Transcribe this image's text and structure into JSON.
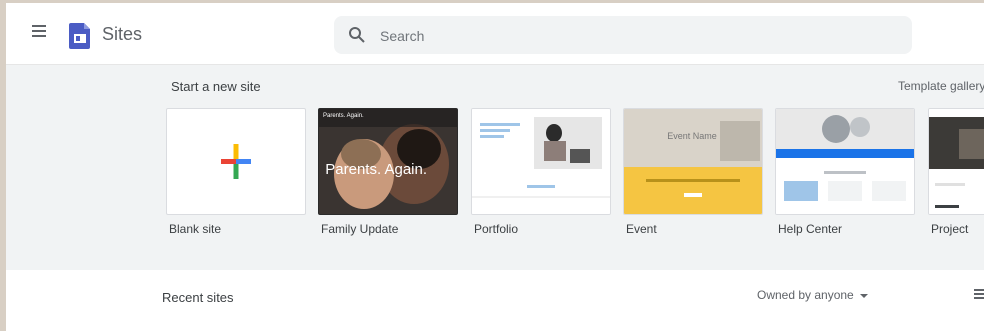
{
  "header": {
    "app_title": "Sites",
    "menu_icon": "hamburger-menu-icon",
    "logo_icon": "google-sites-logo-icon",
    "search_placeholder": "Search",
    "search_value": ""
  },
  "templates_section": {
    "title": "Start a new site",
    "gallery_link": "Template gallery",
    "templates": [
      {
        "label": "Blank site",
        "thumb_icon": "plus-icon"
      },
      {
        "label": "Family Update",
        "thumb_headline": "Parents. Again.",
        "thumb_header": "Parents. Again."
      },
      {
        "label": "Portfolio"
      },
      {
        "label": "Event",
        "thumb_headline": "Event Name"
      },
      {
        "label": "Help Center"
      },
      {
        "label": "Project"
      }
    ]
  },
  "recent": {
    "title": "Recent sites",
    "owner_filter": "Owned by anyone",
    "view_icon": "list-view-icon"
  },
  "colors": {
    "accent_blue": "#4285f4",
    "accent_red": "#ea4335",
    "accent_yellow": "#fbbc04",
    "accent_green": "#34a853",
    "sites_purple": "#4b5cc4"
  }
}
